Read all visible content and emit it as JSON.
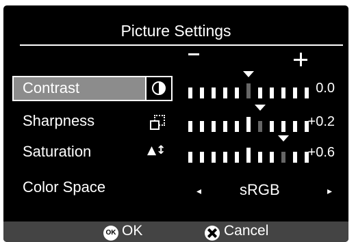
{
  "title": "Picture Settings",
  "scale": {
    "minus_label": "–",
    "plus_label": "+"
  },
  "rows": [
    {
      "label": "Contrast",
      "value": "0.0",
      "level": 0.0,
      "icon": "contrast-icon",
      "selected": true
    },
    {
      "label": "Sharpness",
      "value": "+0.2",
      "level": 0.2,
      "icon": "sharpness-icon",
      "selected": false
    },
    {
      "label": "Saturation",
      "value": "+0.6",
      "level": 0.6,
      "icon": "saturation-icon",
      "selected": false
    }
  ],
  "color_space": {
    "label": "Color Space",
    "value": "sRGB",
    "left_arrow": "◂",
    "right_arrow": "▸"
  },
  "footer": {
    "ok_icon_text": "OK",
    "ok_label": "OK",
    "cancel_label": "Cancel"
  },
  "colors": {
    "background": "#000000",
    "highlight": "#8c8c8c",
    "footer": "#444444",
    "text": "#ffffff"
  }
}
